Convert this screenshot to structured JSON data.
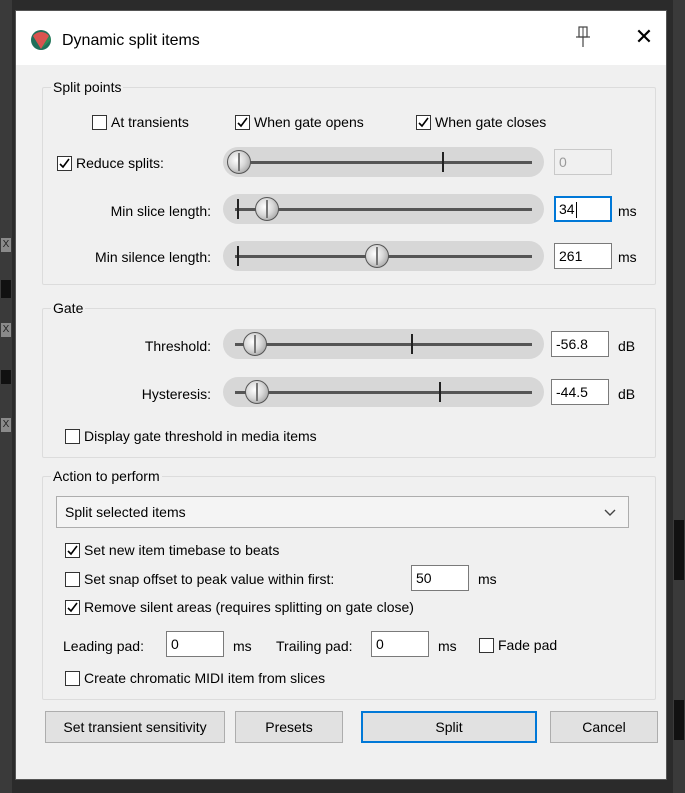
{
  "dialog": {
    "title": "Dynamic split items",
    "icons": {
      "app": "reaper-logo-icon",
      "pin": "pin-icon",
      "close": "close-icon"
    },
    "close_glyph": "✕"
  },
  "background": {
    "track_mark": "X"
  },
  "split_points": {
    "title": "Split points",
    "at_transients": {
      "label": "At transients",
      "checked": false
    },
    "when_gate_opens": {
      "label": "When gate opens",
      "checked": true
    },
    "when_gate_closes": {
      "label": "When gate closes",
      "checked": true
    },
    "reduce_splits": {
      "label": "Reduce splits:",
      "checked": true,
      "value": "0",
      "slider_level": 0.0
    },
    "min_slice_length": {
      "label": "Min slice length:",
      "value": "34",
      "unit": "ms",
      "slider_level": 0.1
    },
    "min_silence_length": {
      "label": "Min silence length:",
      "value": "261",
      "unit": "ms",
      "slider_level": 0.47
    }
  },
  "gate": {
    "title": "Gate",
    "threshold": {
      "label": "Threshold:",
      "value": "-56.8",
      "unit": "dB",
      "slider_level": 0.1
    },
    "hysteresis": {
      "label": "Hysteresis:",
      "value": "-44.5",
      "unit": "dB",
      "slider_level": 0.11
    },
    "display_threshold": {
      "label": "Display gate threshold in media items",
      "checked": false
    }
  },
  "action": {
    "title": "Action to perform",
    "selected": "Split selected items",
    "timebase_beats": {
      "label": "Set new item timebase to beats",
      "checked": true
    },
    "snap_offset": {
      "label": "Set snap offset to peak value within first:",
      "checked": false,
      "value": "50",
      "unit": "ms"
    },
    "remove_silent": {
      "label": "Remove silent areas (requires splitting on gate close)",
      "checked": true
    },
    "leading_pad": {
      "label": "Leading pad:",
      "value": "0",
      "unit": "ms"
    },
    "trailing_pad": {
      "label": "Trailing pad:",
      "value": "0",
      "unit": "ms"
    },
    "fade_pad": {
      "label": "Fade pad",
      "checked": false
    },
    "chromatic_midi": {
      "label": "Create chromatic MIDI item from slices",
      "checked": false
    }
  },
  "buttons": {
    "set_transient_sensitivity": "Set transient sensitivity",
    "presets": "Presets",
    "split": "Split",
    "cancel": "Cancel"
  },
  "colors": {
    "accent": "#0078d7",
    "dialog_bg": "#f0f0f0"
  }
}
